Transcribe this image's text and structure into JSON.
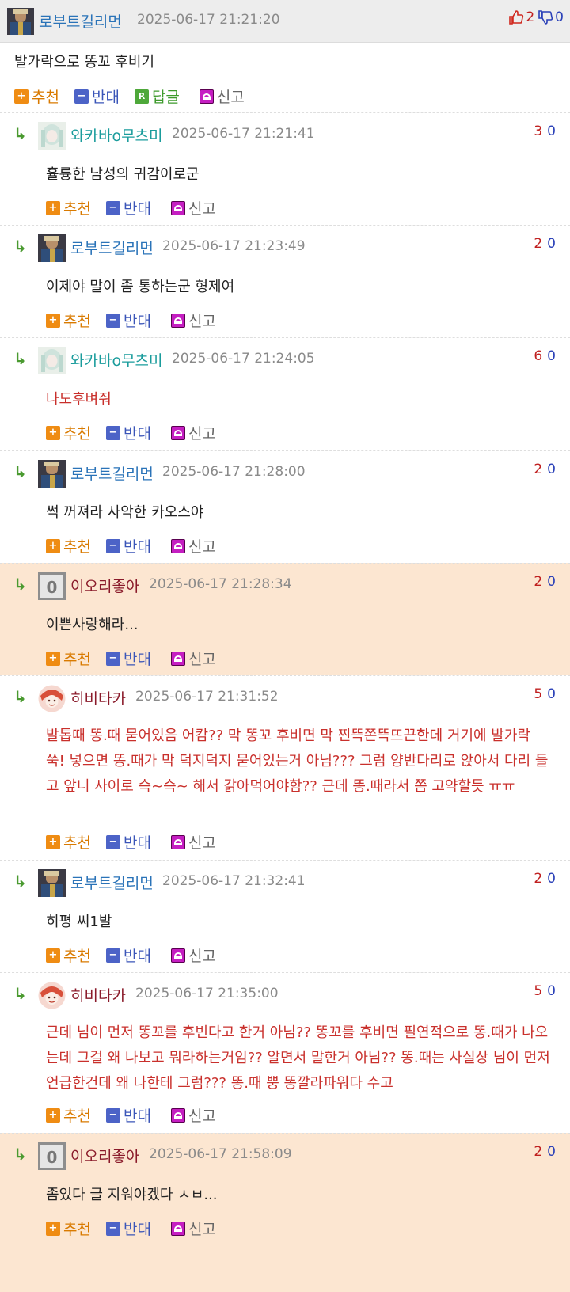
{
  "post": {
    "author": "로부트길리먼",
    "time": "2025-06-17 21:21:20",
    "likes": "2",
    "dislikes": "0",
    "text": "발가락으로 똥꼬 후비기",
    "actions": {
      "up": "추천",
      "down": "반대",
      "reply": "답글",
      "report": "신고",
      "reply_badge": "R"
    }
  },
  "action_labels": {
    "up": "추천",
    "down": "반대",
    "report": "신고",
    "up_icon": "+",
    "down_icon": "−"
  },
  "comments": [
    {
      "nick": "와카바o무츠미",
      "time": "2025-06-17 21:21:41",
      "up": "3",
      "down": "0",
      "text": "휼륭한 남성의 귀감이로군"
    },
    {
      "nick": "로부트길리먼",
      "time": "2025-06-17 21:23:49",
      "up": "2",
      "down": "0",
      "text": "이제야 말이 좀 통하는군 형제여"
    },
    {
      "nick": "와카바o무츠미",
      "time": "2025-06-17 21:24:05",
      "up": "6",
      "down": "0",
      "text": "나도후벼줘"
    },
    {
      "nick": "로부트길리먼",
      "time": "2025-06-17 21:28:00",
      "up": "2",
      "down": "0",
      "text": "썩 꺼져라 사악한 카오스야"
    },
    {
      "nick": "이오리좋아",
      "time": "2025-06-17 21:28:34",
      "up": "2",
      "down": "0",
      "text": "이쁜사랑해라..."
    },
    {
      "nick": "히비타카",
      "time": "2025-06-17 21:31:52",
      "up": "5",
      "down": "0",
      "text": "발톱때 똥.때 묻어있음 어캄?? 막 똥꼬 후비면 막 찐뜩쫀뜩뜨끈한데 거기에 발가락 쑥! 넣으면 똥.때가 막 덕지덕지 묻어있는거 아님??? 그럼 양반다리로 앉아서 다리 들고 앞니 사이로 슥~슥~ 해서 갉아먹어야함?? 근데 똥.때라서 쫌 고약할듯 ㅠㅠ"
    },
    {
      "nick": "로부트길리먼",
      "time": "2025-06-17 21:32:41",
      "up": "2",
      "down": "0",
      "text": "히평 씨1발"
    },
    {
      "nick": "히비타카",
      "time": "2025-06-17 21:35:00",
      "up": "5",
      "down": "0",
      "text": "근데 님이 먼저 똥꼬를 후빈다고 한거 아님?? 똥꼬를 후비면 필연적으로 똥.때가 나오는데 그걸 왜 나보고 뭐라하는거임?? 알면서 말한거 아님?? 똥.때는 사실상 님이 먼저 언급한건데 왜 나한테 그럼??? 똥.때 뿡 똥깔라파워다 수고"
    },
    {
      "nick": "이오리좋아",
      "time": "2025-06-17 21:58:09",
      "up": "2",
      "down": "0",
      "text": "좀있다 글 지워야겠다 ㅅㅂ..."
    }
  ],
  "colors": {
    "accent_up": "#ef8c13",
    "accent_down": "#4c63c7",
    "highlight_bg": "#fce6d1",
    "nick_blue": "#2a73b8"
  }
}
